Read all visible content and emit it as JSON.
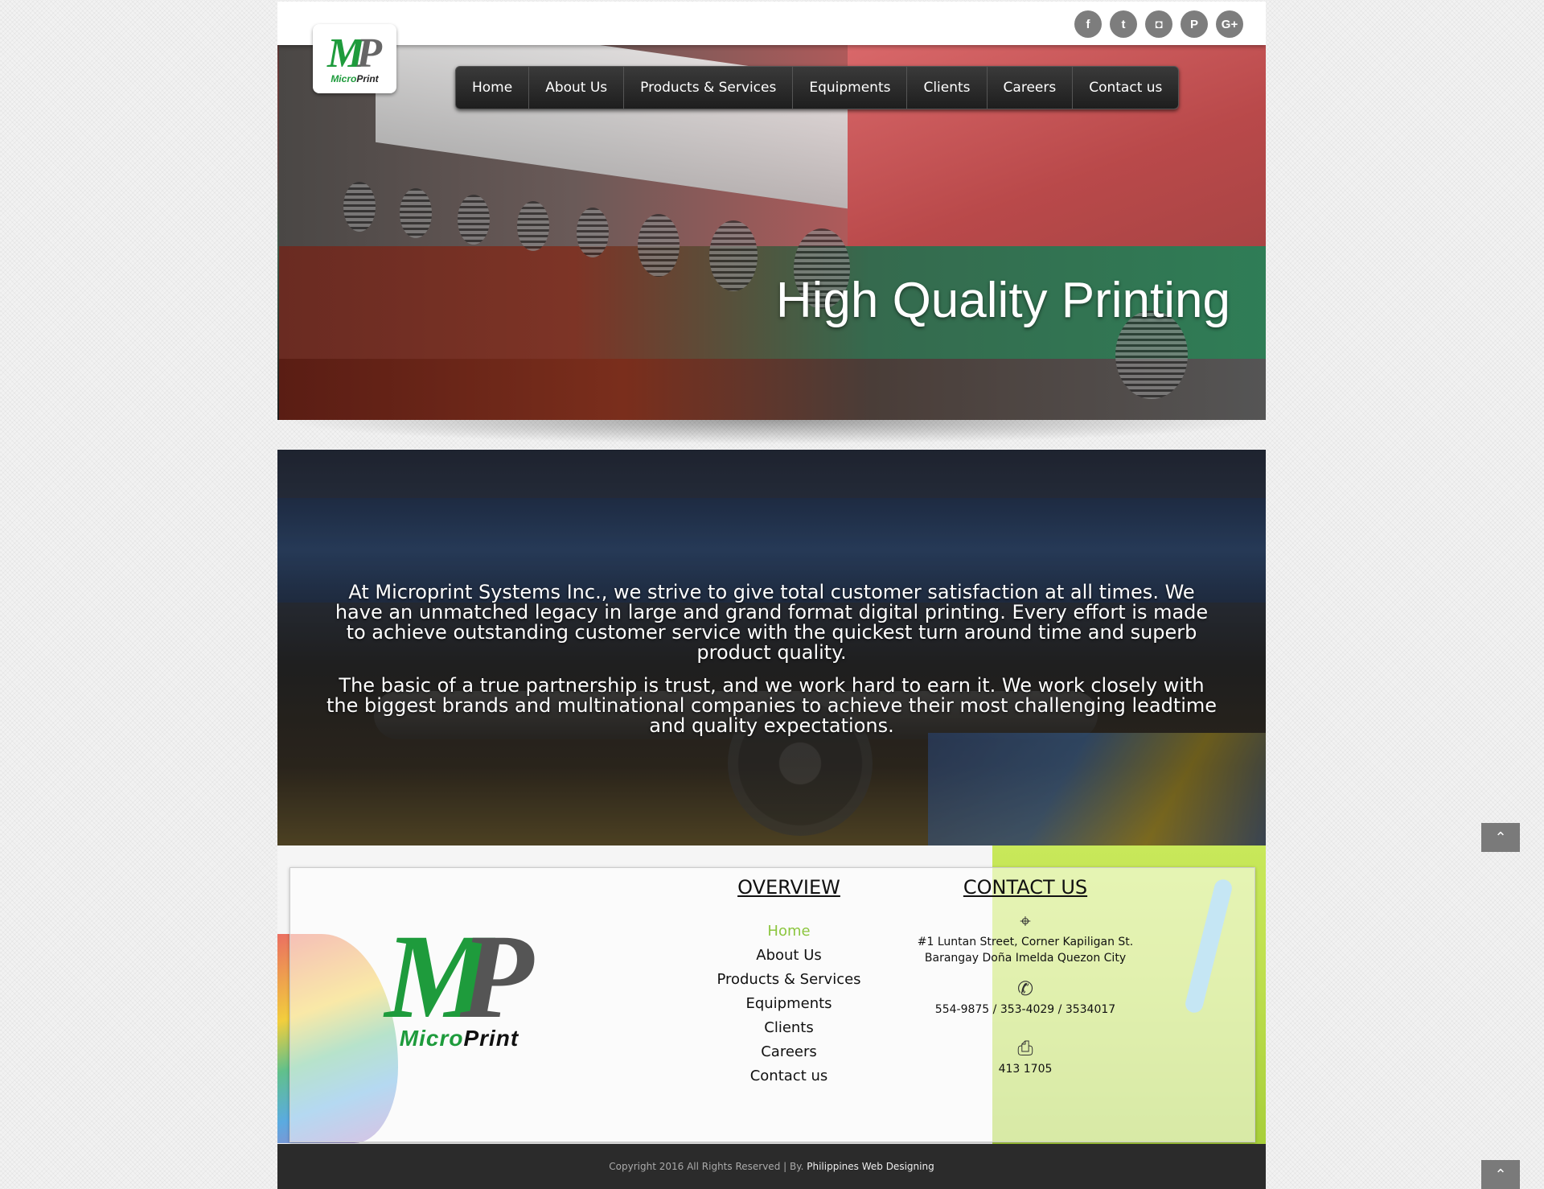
{
  "social": [
    {
      "icon": "facebook-icon",
      "glyph": "f"
    },
    {
      "icon": "twitter-icon",
      "glyph": "t"
    },
    {
      "icon": "instagram-icon",
      "glyph": "◘"
    },
    {
      "icon": "pinterest-icon",
      "glyph": "P"
    },
    {
      "icon": "google-plus-icon",
      "glyph": "G+"
    }
  ],
  "logo": {
    "mark_m": "M",
    "mark_p": "P",
    "text_a": "Micro",
    "text_b": "Print"
  },
  "nav": [
    "Home",
    "About Us",
    "Products & Services",
    "Equipments",
    "Clients",
    "Careers",
    "Contact us"
  ],
  "hero": {
    "title": "High Quality Printing"
  },
  "about": {
    "p1": "At Microprint Systems Inc., we strive to give total customer satisfaction at all times. We have an unmatched legacy in large and grand format digital printing. Every effort is made to achieve outstanding customer service with the quickest turn around time and superb product quality.",
    "p2": "The basic of a true partnership is trust, and we work hard to earn it. We work closely with the biggest brands and multinational companies to achieve their most challenging leadtime and quality expectations."
  },
  "footer": {
    "overview_title": "OVERVIEW",
    "overview_links": [
      "Home",
      "About Us",
      "Products & Services",
      "Equipments",
      "Clients",
      "Careers",
      "Contact us"
    ],
    "contact_title": "CONTACT US",
    "address": "#1 Luntan Street, Corner Kapiligan St. Barangay Doña Imelda Quezon City",
    "phone": "554-9875 / 353-4029 / 3534017",
    "fax": "413 1705",
    "copyright": "Copyright 2016 All Rights Reserved | By.",
    "credit": "Philippines Web Designing"
  },
  "icons": {
    "location": "map-marker-icon",
    "phone": "phone-icon",
    "fax": "fax-icon",
    "up": "chevron-up-icon"
  },
  "colors": {
    "accent_green": "#8cc63f",
    "logo_green": "#1e9b3c",
    "nav_bg": "#2a2a2a",
    "footer_bar": "#2b2b2b"
  }
}
